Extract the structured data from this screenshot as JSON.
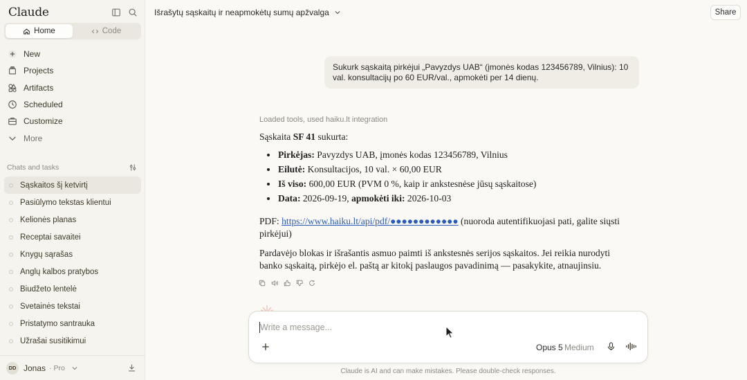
{
  "app": {
    "brand": "Claude"
  },
  "sidebar": {
    "modes": [
      {
        "label": "Home",
        "active": true
      },
      {
        "label": "Code",
        "active": false
      }
    ],
    "nav": [
      {
        "label": "New",
        "icon": "plus-icon"
      },
      {
        "label": "Projects",
        "icon": "projects-icon"
      },
      {
        "label": "Artifacts",
        "icon": "artifacts-icon"
      },
      {
        "label": "Scheduled",
        "icon": "clock-icon"
      },
      {
        "label": "Customize",
        "icon": "briefcase-icon"
      },
      {
        "label": "More",
        "icon": "chevron-down-icon"
      }
    ],
    "section_label": "Chats and tasks",
    "chats": [
      {
        "label": "Sąskaitos šį ketvirtį",
        "active": true
      },
      {
        "label": "Pasiūlymo tekstas klientui"
      },
      {
        "label": "Kelionės planas"
      },
      {
        "label": "Receptai savaitei"
      },
      {
        "label": "Knygų sąrašas"
      },
      {
        "label": "Anglų kalbos pratybos"
      },
      {
        "label": "Biudžeto lentelė"
      },
      {
        "label": "Svetainės tekstai"
      },
      {
        "label": "Pristatymo santrauka"
      },
      {
        "label": "Užrašai susitikimui"
      }
    ],
    "user": {
      "initials": "DD",
      "name": "Jonas",
      "plan": "· Pro"
    }
  },
  "header": {
    "title": "Išrašytų sąskaitų ir neapmokėtų sumų apžvalga",
    "share_label": "Share"
  },
  "conversation": {
    "user_message": "Sukurk sąskaitą pirkėjui „Pavyzdys UAB“ (įmonės kodas 123456789, Vilnius): 10 val. konsultacijų po 60 EUR/val., apmokėti per 14 dienų.",
    "tools_line": "Loaded tools, used haiku.lt integration",
    "intro_prefix": "Sąskaita ",
    "intro_bold": "SF 41",
    "intro_suffix": " sukurta:",
    "bullets": [
      {
        "label": "Pirkėjas:",
        "text": " Pavyzdys UAB, įmonės kodas 123456789, Vilnius"
      },
      {
        "label": "Eilutė:",
        "text": " Konsultacijos, 10 val. × 60,00 EUR"
      },
      {
        "label": "Iš viso:",
        "text": " 600,00 EUR (PVM 0 %, kaip ir ankstesnėse jūsų sąskaitose)"
      }
    ],
    "date_label": "Data:",
    "date_value": " 2026-09-19, ",
    "due_label": "apmokėti iki:",
    "due_value": " 2026-10-03",
    "pdf_label": "PDF: ",
    "pdf_link": "https://www.haiku.lt/api/pdf/●●●●●●●●●●●●",
    "pdf_note": " (nuoroda autentifikuojasi pati, galite siųsti pirkėjui)",
    "closing": "Pardavėjo blokas ir išrašantis asmuo paimti iš ankstesnės serijos sąskaitos. Jei reikia nurodyti banko sąskaitą, pirkėjo el. paštą ar kitokį paslaugos pavadinimą — pasakykite, atnaujinsiu."
  },
  "composer": {
    "placeholder": "Write a message...",
    "model": "Opus 5",
    "effort": "Medium"
  },
  "footer": {
    "disclaimer": "Claude is AI and can make mistakes. Please double-check responses."
  }
}
